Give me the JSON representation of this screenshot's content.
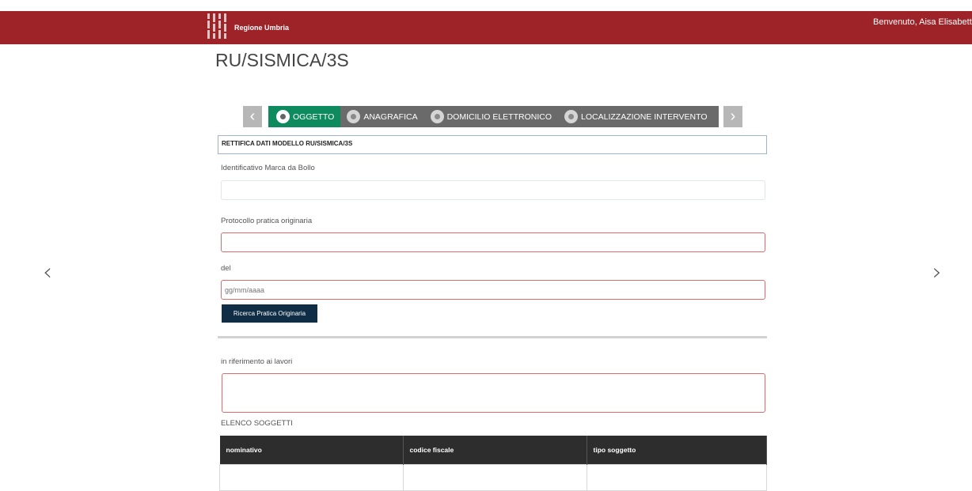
{
  "header": {
    "brand": "Regione Umbria",
    "welcome": "Benvenuto, Aisa Elisabetta"
  },
  "page": {
    "title": "RU/SISMICA/3S"
  },
  "stepper": {
    "prev_icon": "chevron-left-icon",
    "next_icon": "chevron-right-icon",
    "steps": [
      {
        "label": "OGGETTO",
        "active": true
      },
      {
        "label": "ANAGRAFICA",
        "active": false
      },
      {
        "label": "DOMICILIO ELETTRONICO",
        "active": false
      },
      {
        "label": "LOCALIZZAZIONE INTERVENTO",
        "active": false
      }
    ]
  },
  "form": {
    "section_title": "RETTIFICA DATI MODELLO RU/SISMICA/3S",
    "marca_label": "Identificativo Marca da Bollo",
    "marca_value": "",
    "protocollo_label": "Protocollo pratica originaria",
    "protocollo_value": "",
    "del_label": "del",
    "del_placeholder": "gg/mm/aaaa",
    "search_button": "Ricerca Pratica Originaria",
    "lavori_label": "in riferimento ai lavori",
    "soggetti_label": "ELENCO SOGGETTI"
  },
  "table": {
    "headers": [
      "nominativo",
      "codice fiscale",
      "tipo soggetto"
    ]
  },
  "colors": {
    "header_bg": "#9e2328",
    "active_step": "#0e8a5f",
    "button_bg": "#0f2d45",
    "error_border": "#e06b6b"
  }
}
